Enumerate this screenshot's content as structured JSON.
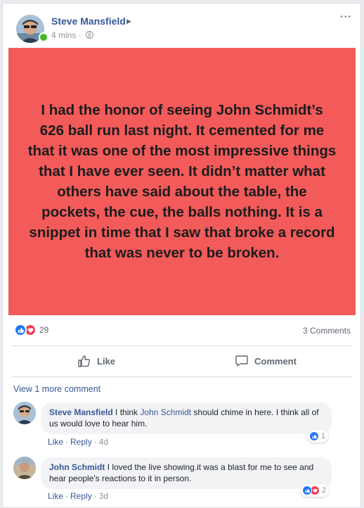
{
  "post": {
    "author": "Steve Mansfield",
    "time": "4 mins",
    "text": "I had the honor of seeing John Schmidt’s 626 ball run last night. It cemented for me that it was one of the most impressive things that I have ever seen. It didn’t matter what others have said about the table, the pockets, the cue, the balls nothing. It is a snippet in time that I saw that broke a record that was never to be broken.",
    "background_color": "#f35a5a",
    "more_icon": "more-options-icon",
    "privacy_icon": "globe-icon"
  },
  "stats": {
    "reaction_count": "29",
    "reaction_icons": [
      "like-icon",
      "love-icon"
    ],
    "comments_label": "3 Comments"
  },
  "actions": {
    "like_label": "Like",
    "comment_label": "Comment"
  },
  "view_more_label": "View 1 more comment",
  "comments": [
    {
      "author": "Steve Mansfield",
      "text_before": " I think ",
      "mention": "John Schmidt",
      "text_after": " should chime in here. I think all of us would love to hear him.",
      "like_label": "Like",
      "reply_label": "Reply",
      "time": "4d",
      "reaction_count": "1",
      "reactions": [
        "like-icon"
      ]
    },
    {
      "author": "John Schmidt",
      "text_before": " I loved the live showing.it was a blast for me to see and hear people's reactions to it in person.",
      "mention": "",
      "text_after": "",
      "like_label": "Like",
      "reply_label": "Reply",
      "time": "3d",
      "reaction_count": "2",
      "reactions": [
        "like-icon",
        "love-icon"
      ]
    }
  ],
  "colors": {
    "link_blue": "#365899",
    "like_blue": "#2078f4",
    "love_red": "#f33e58",
    "online_green": "#42b72a"
  }
}
